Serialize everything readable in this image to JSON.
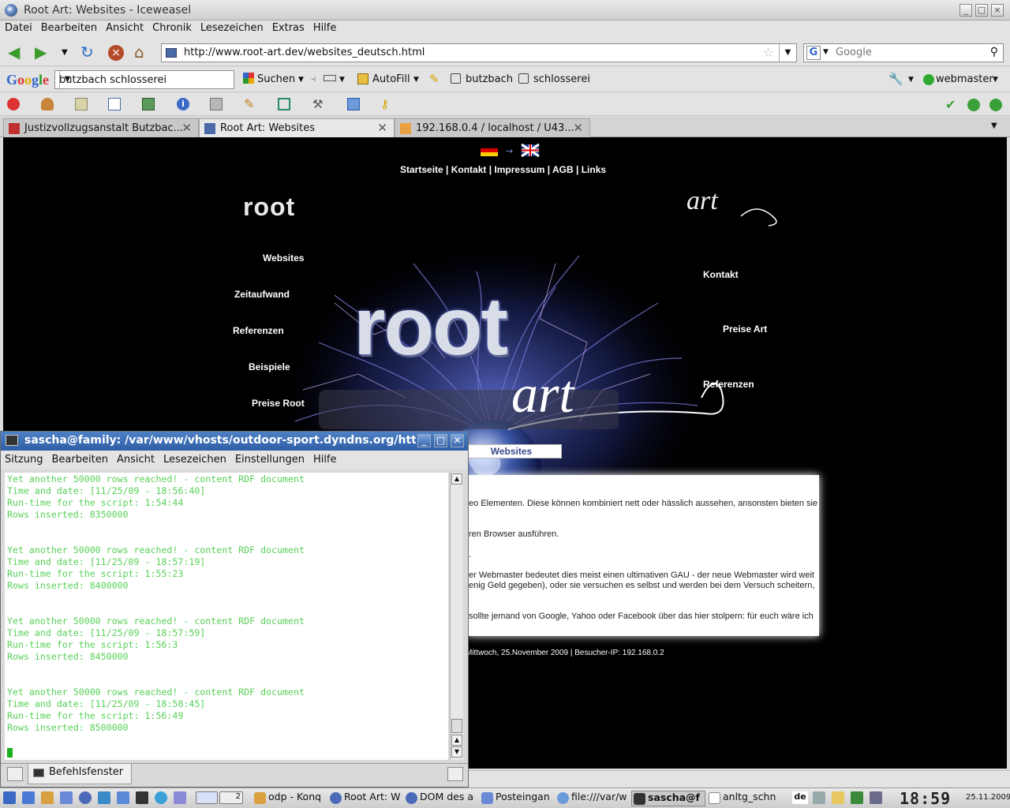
{
  "window": {
    "title": "Root Art: Websites - Iceweasel"
  },
  "menubar": [
    "Datei",
    "Bearbeiten",
    "Ansicht",
    "Chronik",
    "Lesezeichen",
    "Extras",
    "Hilfe"
  ],
  "url": "http://www.root-art.dev/websites_deutsch.html",
  "search_placeholder": "Google",
  "googlebar": {
    "logo": "Google",
    "query": "butzbach schlosserei",
    "suchen": "Suchen",
    "autofill": "AutoFill",
    "term1": "butzbach",
    "term2": "schlosserei",
    "user": "webmaster"
  },
  "tabs": [
    "Justizvollzugsanstalt Butzbac...",
    "Root Art: Websites",
    "192.168.0.4 / localhost / U43..."
  ],
  "page": {
    "topnav": "Startseite | Kontakt | Impressum | AGB | Links",
    "logo_left": "root",
    "logo_right": "art",
    "big_logo": "root",
    "big_logo_art": "art",
    "left_nav": [
      "Websites",
      "Zeitaufwand",
      "Referenzen",
      "Beispiele",
      "Preise Root"
    ],
    "right_nav": [
      "Kontakt",
      "Preise Art",
      "Referenzen"
    ],
    "section_title": "Websites",
    "panel_lines": [
      "eo Elementen. Diese können kombiniert nett oder hässlich aussehen, ansonsten bieten sie",
      "ren Browser ausführen.",
      ".",
      "er Webmaster bedeutet dies meist einen ultimativen GAU - der neue Webmaster wird weit",
      "enig Geld gegeben), oder sie versuchen es selbst und werden bei dem Versuch scheitern,",
      "sollte jemand von Google, Yahoo oder Facebook über das hier stolpern: für euch wäre ich"
    ],
    "footer": "Mittwoch, 25.November 2009 | Besucher-IP: 192.168.0.2"
  },
  "konsole": {
    "title": "sascha@family: /var/www/vhosts/outdoor-sport.dyndns.org/httpdocs/r",
    "menu": [
      "Sitzung",
      "Bearbeiten",
      "Ansicht",
      "Lesezeichen",
      "Einstellungen",
      "Hilfe"
    ],
    "output": "Yet another 50000 rows reached! - content RDF document\nTime and date: [11/25/09 - 18:56:40]\nRun-time for the script: 1:54:44\nRows inserted: 8350000\n\n\nYet another 50000 rows reached! - content RDF document\nTime and date: [11/25/09 - 18:57:19]\nRun-time for the script: 1:55:23\nRows inserted: 8400000\n\n\nYet another 50000 rows reached! - content RDF document\nTime and date: [11/25/09 - 18:57:59]\nRun-time for the script: 1:56:3\nRows inserted: 8450000\n\n\nYet another 50000 rows reached! - content RDF document\nTime and date: [11/25/09 - 18:58:45]\nRun-time for the script: 1:56:49\nRows inserted: 8500000",
    "tab": "Befehlsfenster"
  },
  "taskbar": {
    "items": [
      "odp - Konq",
      "Root Art: W",
      "DOM des a",
      "Posteingan",
      "file:///var/w",
      "sascha@f",
      "anltg_schn"
    ],
    "desktop_num": "2",
    "lang": "de",
    "clock": "18:59",
    "date": "25.11.2009"
  },
  "colors": {
    "terminal_text": "#58d058",
    "konsole_title": "#2f5ea5",
    "page_bg": "#000000"
  }
}
